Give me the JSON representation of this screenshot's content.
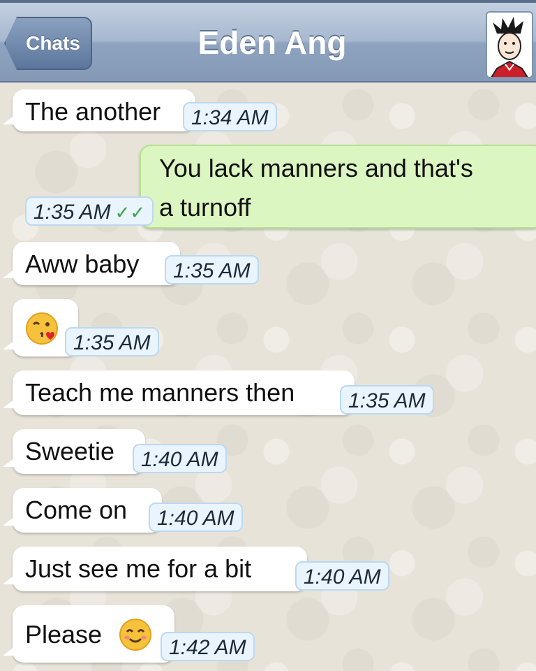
{
  "header": {
    "back_label": "Chats",
    "contact_name": "Eden Ang",
    "avatar_icon": "cartoon-avatar"
  },
  "messages": [
    {
      "direction": "incoming",
      "text": "The another",
      "time": "1:34 AM"
    },
    {
      "direction": "outgoing",
      "text_line1": "You lack manners and that's",
      "text_line2": "a turnoff",
      "time": "1:35 AM",
      "status": "read-double-check"
    },
    {
      "direction": "incoming",
      "text": "Aww baby",
      "time": "1:35 AM"
    },
    {
      "direction": "incoming",
      "text": "",
      "emoji": "face-throwing-kiss",
      "time": "1:35 AM"
    },
    {
      "direction": "incoming",
      "text": "Teach me manners then",
      "time": "1:35 AM"
    },
    {
      "direction": "incoming",
      "text": "Sweetie",
      "time": "1:40 AM"
    },
    {
      "direction": "incoming",
      "text": "Come on",
      "time": "1:40 AM"
    },
    {
      "direction": "incoming",
      "text": "Just see me for a bit",
      "time": "1:40 AM"
    },
    {
      "direction": "incoming",
      "text": "Please",
      "emoji": "smiling-face",
      "time": "1:42 AM"
    }
  ],
  "colors": {
    "navbar": "#9fb2cb",
    "incoming_bubble": "#ffffff",
    "outgoing_bubble": "#dcf6c2",
    "timestamp_bg": "#eaf4fc",
    "read_tick": "#3aa54a"
  }
}
